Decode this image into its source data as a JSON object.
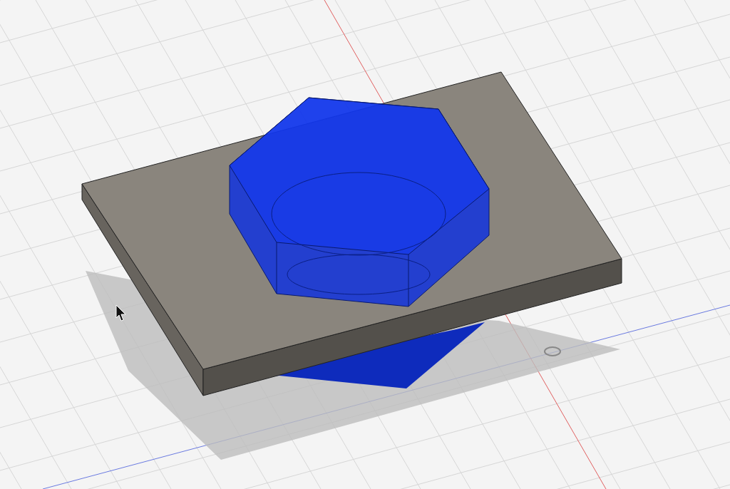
{
  "viewport": {
    "grid": true,
    "bodies": [
      {
        "kind": "plate",
        "color": "#8a857d"
      },
      {
        "kind": "hex",
        "color": "#1133dd"
      }
    ]
  }
}
